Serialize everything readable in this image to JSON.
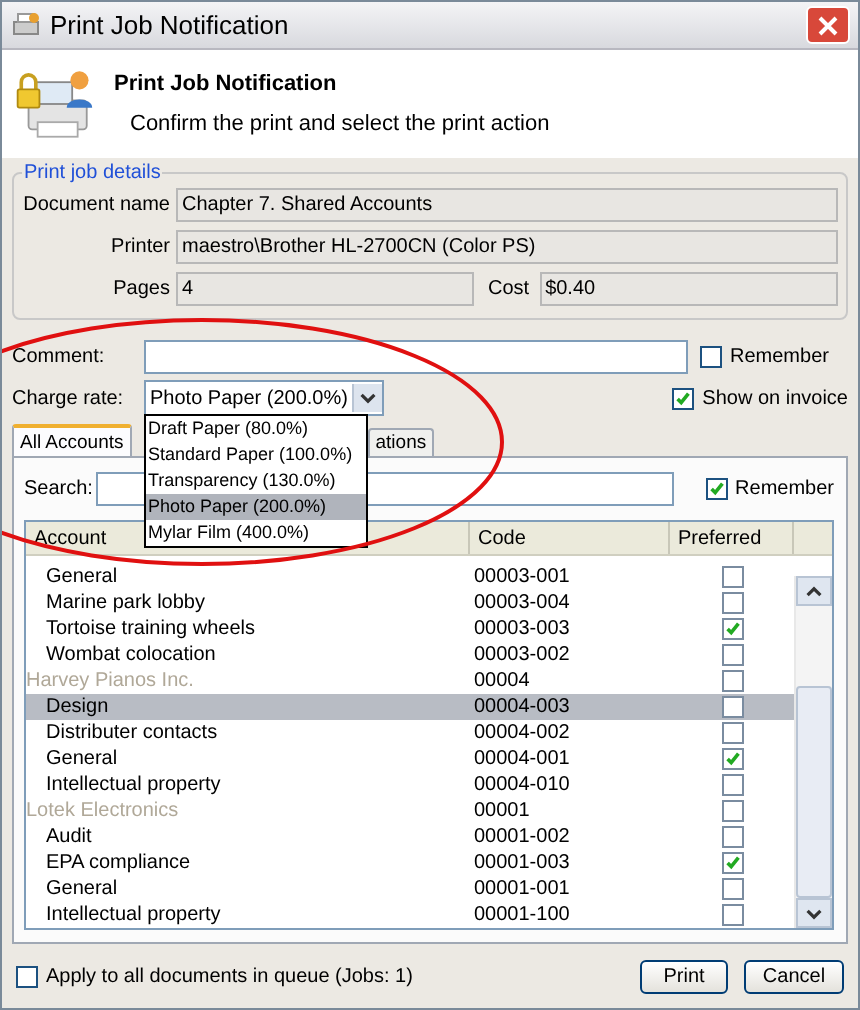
{
  "window": {
    "title": "Print Job Notification"
  },
  "header": {
    "title": "Print Job Notification",
    "subtitle": "Confirm the print and select the print action"
  },
  "details": {
    "legend": "Print job details",
    "fields": [
      {
        "label": "Document name",
        "value": "Chapter 7. Shared Accounts"
      },
      {
        "label": "Printer",
        "value": "maestro\\Brother HL-2700CN (Color PS)"
      }
    ],
    "pages": {
      "label": "Pages",
      "value": "4"
    },
    "cost": {
      "label": "Cost",
      "value": "$0.40"
    }
  },
  "comment": {
    "label": "Comment:",
    "remember": {
      "label": "Remember",
      "checked": false
    }
  },
  "charge_rate": {
    "label": "Charge rate:",
    "value": "Photo Paper (200.0%)",
    "expanded": true,
    "options": [
      {
        "label": "Draft Paper (80.0%)",
        "selected": false
      },
      {
        "label": "Standard Paper (100.0%)",
        "selected": false
      },
      {
        "label": "Transparency (130.0%)",
        "selected": false
      },
      {
        "label": "Photo Paper (200.0%)",
        "selected": true
      },
      {
        "label": "Mylar Film (400.0%)",
        "selected": false
      }
    ],
    "show_on_invoice": {
      "label": "Show on invoice",
      "checked": true
    }
  },
  "tabs": [
    {
      "label": "All Accounts",
      "selected": true
    },
    {
      "label": "ations",
      "selected": false
    }
  ],
  "search": {
    "label": "Search:",
    "remember": {
      "label": "Remember",
      "checked": true
    }
  },
  "table": {
    "columns": [
      "Account",
      "Code",
      "Preferred"
    ],
    "rows": [
      {
        "kind": "item",
        "name": "General",
        "code": "00003-001",
        "preferred": false,
        "selected": false
      },
      {
        "kind": "item",
        "name": "Marine park lobby",
        "code": "00003-004",
        "preferred": false,
        "selected": false
      },
      {
        "kind": "item",
        "name": "Tortoise training wheels",
        "code": "00003-003",
        "preferred": true,
        "selected": false
      },
      {
        "kind": "item",
        "name": "Wombat colocation",
        "code": "00003-002",
        "preferred": false,
        "selected": false
      },
      {
        "kind": "group",
        "name": "Harvey Pianos Inc.",
        "code": "00004",
        "preferred": false,
        "selected": false
      },
      {
        "kind": "item",
        "name": "Design",
        "code": "00004-003",
        "preferred": false,
        "selected": true
      },
      {
        "kind": "item",
        "name": "Distributer contacts",
        "code": "00004-002",
        "preferred": false,
        "selected": false
      },
      {
        "kind": "item",
        "name": "General",
        "code": "00004-001",
        "preferred": true,
        "selected": false
      },
      {
        "kind": "item",
        "name": "Intellectual property",
        "code": "00004-010",
        "preferred": false,
        "selected": false
      },
      {
        "kind": "group",
        "name": "Lotek Electronics",
        "code": "00001",
        "preferred": false,
        "selected": false
      },
      {
        "kind": "item",
        "name": "Audit",
        "code": "00001-002",
        "preferred": false,
        "selected": false
      },
      {
        "kind": "item",
        "name": "EPA compliance",
        "code": "00001-003",
        "preferred": true,
        "selected": false
      },
      {
        "kind": "item",
        "name": "General",
        "code": "00001-001",
        "preferred": false,
        "selected": false
      },
      {
        "kind": "item",
        "name": "Intellectual property",
        "code": "00001-100",
        "preferred": false,
        "selected": false
      }
    ]
  },
  "apply_all": {
    "label": "Apply to all documents in queue (Jobs: 1)",
    "checked": false
  },
  "buttons": [
    {
      "label": "Print"
    },
    {
      "label": "Cancel"
    }
  ]
}
